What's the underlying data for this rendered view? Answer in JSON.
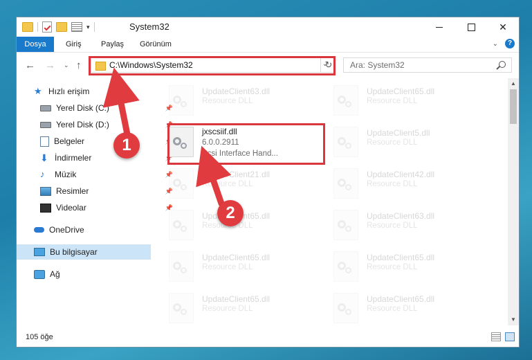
{
  "window": {
    "title": "System32",
    "controls": {
      "minimize": "minimize",
      "maximize": "maximize",
      "close": "✕"
    }
  },
  "ribbon": {
    "tabs": [
      "Dosya",
      "Giriş",
      "Paylaş",
      "Görünüm"
    ],
    "help": "?"
  },
  "navigation": {
    "address": "C:\\Windows\\System32",
    "search_placeholder": "Ara: System32"
  },
  "sidebar": {
    "quick_access": "Hızlı erişim",
    "items": [
      {
        "label": "Yerel Disk (C:)",
        "icon": "drive-icon"
      },
      {
        "label": "Yerel Disk (D:)",
        "icon": "drive-icon"
      },
      {
        "label": "Belgeler",
        "icon": "documents-icon"
      },
      {
        "label": "İndirmeler",
        "icon": "downloads-icon"
      },
      {
        "label": "Müzik",
        "icon": "music-icon"
      },
      {
        "label": "Resimler",
        "icon": "pictures-icon"
      },
      {
        "label": "Videolar",
        "icon": "videos-icon"
      }
    ],
    "onedrive": "OneDrive",
    "this_pc": "Bu bilgisayar",
    "network": "Ağ"
  },
  "files": {
    "left": [
      {
        "name": "UpdateClient63.dll",
        "desc": "Resource DLL"
      },
      {
        "name": "UpdateClient21.dll",
        "desc": "Resource DLL"
      },
      {
        "name": "UpdateClient65.dll",
        "desc": "Resource DLL"
      },
      {
        "name": "UpdateClient65.dll",
        "desc": "Resource DLL"
      },
      {
        "name": "UpdateClient65.dll",
        "desc": "Resource DLL"
      }
    ],
    "right": [
      {
        "name": "UpdateClient65.dll",
        "desc": "Resource DLL"
      },
      {
        "name": "UpdateClient5.dll",
        "desc": "Resource DLL"
      },
      {
        "name": "UpdateClient42.dll",
        "desc": "Resource DLL"
      },
      {
        "name": "UpdateClient63.dll",
        "desc": "Resource DLL"
      },
      {
        "name": "UpdateClient65.dll",
        "desc": "Resource DLL"
      },
      {
        "name": "UpdateClient65.dll",
        "desc": "Resource DLL"
      }
    ],
    "highlighted": {
      "name": "jxscsiif.dll",
      "version": "6.0.0.2911",
      "desc": "Scsi Interface Hand..."
    }
  },
  "status": {
    "count": "105 öğe"
  },
  "annotations": {
    "step1": "1",
    "step2": "2",
    "color": "#d9363e"
  }
}
